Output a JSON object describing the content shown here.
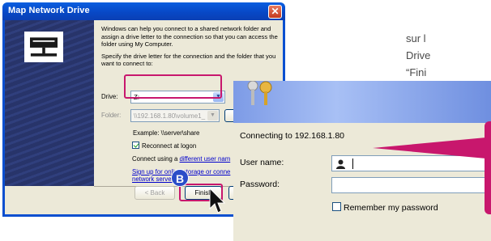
{
  "map_dialog": {
    "title": "Map Network Drive",
    "intro": "Windows can help you connect to a shared network folder and assign a drive letter to the connection so that you can access the folder using My Computer.",
    "specify": "Specify the drive letter for the connection and the folder that you want to connect to:",
    "drive_label": "Drive:",
    "drive_value": "Z:",
    "folder_label": "Folder:",
    "folder_value": "\\\\192.168.1.80\\volume1_",
    "example": "Example: \\\\server\\share",
    "reconnect_label": "Reconnect at logon",
    "reconnect_checked": true,
    "connect_prefix": "Connect using a ",
    "connect_link": "different user nam",
    "signup_link_1": "Sign up for online storage or conne",
    "signup_link_2": "network server.",
    "back_button": "< Back",
    "finish_button": "Finish",
    "step_badge": "B"
  },
  "desc": {
    "line1": "sur l",
    "line2": "Drive",
    "line3": "“Fini"
  },
  "connect_dialog": {
    "connecting_text": "Connecting to 192.168.1.80",
    "username_label": "User name:",
    "password_label": "Password:",
    "remember_label": "Remember my password",
    "remember_checked": false
  },
  "colors": {
    "highlight": "#c8176d",
    "xp_title_blue": "#0848c6",
    "badge_blue": "#2a4dc8"
  }
}
